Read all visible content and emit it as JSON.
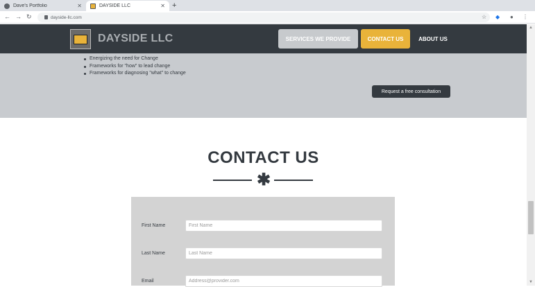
{
  "browser": {
    "tabs": [
      {
        "label": "Dave's Portfolio",
        "active": false
      },
      {
        "label": "DAYSIDE LLC",
        "active": true
      }
    ],
    "new_tab_label": "+",
    "address": "dayside-llc.com"
  },
  "header": {
    "brand": "DAYSIDE LLC",
    "nav": {
      "services": "SERVICES WE PROVIDE",
      "contact": "CONTACT US",
      "about": "ABOUT US"
    }
  },
  "services": {
    "bullets": [
      "Energizing the need for Change",
      "Frameworks for \"how\" to lead change",
      "Frameworks for diagnosing \"what\" to change"
    ],
    "consult_button": "Request a free consultation"
  },
  "contact": {
    "title": "CONTACT US",
    "divider_glyph": "✱",
    "fields": [
      {
        "label": "First Name",
        "placeholder": "First Name"
      },
      {
        "label": "Last Name",
        "placeholder": "Last Name"
      },
      {
        "label": "Email",
        "placeholder": "Address@provider.com"
      }
    ]
  },
  "colors": {
    "header_bg": "#343a40",
    "accent": "#e9b33a",
    "section_gray": "#c8cbcf",
    "form_bg": "#d3d3d3"
  },
  "icons": [
    "back-arrow-icon",
    "forward-arrow-icon",
    "reload-icon",
    "lock-icon",
    "star-icon",
    "extension-icon",
    "profile-icon",
    "menu-icon",
    "tab-close-icon",
    "logo-icon",
    "asterisk-divider-icon"
  ]
}
